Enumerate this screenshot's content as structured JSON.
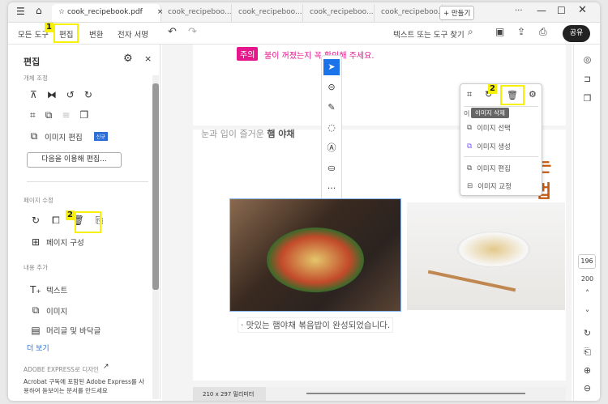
{
  "titlebar": {
    "tabs": [
      "cook_recipebook.pdf",
      "cook_recipeboo...",
      "cook_recipeboo...",
      "cook_recipeboo...",
      "cook_recipeboo..."
    ],
    "new_tab": "+ 만들기"
  },
  "toolbar": {
    "all_tools": "모든 도구",
    "edit": "편집",
    "convert": "변환",
    "esign": "전자 서명",
    "search": "텍스트 또는 도구 찾기",
    "share": "공유",
    "badge1": "1"
  },
  "panel": {
    "title": "편집",
    "sec_objects": "개체 조정",
    "image_edit": "이미지 편집",
    "new_badge": "신규",
    "edit_with": "다음을 이용해 편집...",
    "sec_pages": "페이지 수정",
    "badge2": "2",
    "page_org": "페이지 구성",
    "sec_add": "내용 추가",
    "text": "텍스트",
    "image": "이미지",
    "header_footer": "머리글 및 바닥글",
    "more": "더 보기",
    "adobe_express": "ADOBE EXPRESS로 디자인",
    "express_desc": "Acrobat 구독에 포함된 Adobe Express를 사용하여 돋보이는 문서를 만드세요"
  },
  "document": {
    "caution_label": "주의",
    "caution_text": "불이 꺼졌는지 꼭 확인해 주세요.",
    "subtitle_normal": "눈과 입이 즐거운 ",
    "subtitle_bold": "햄 야채",
    "heading_partial": "는 법",
    "caption": "· 맛있는 햄야채 볶음밥이 완성되었습니다.",
    "page_size": "210 x 297 밀리미터"
  },
  "popup": {
    "badge": "2",
    "tooltip": "이미지 삭제",
    "hidden_prefix": "이",
    "select": "이미지 선택",
    "generate": "이미지 생성",
    "edit": "이미지 편집",
    "replace": "이미지 교정"
  },
  "rail": {
    "page_current": "196",
    "page_total": "200"
  }
}
